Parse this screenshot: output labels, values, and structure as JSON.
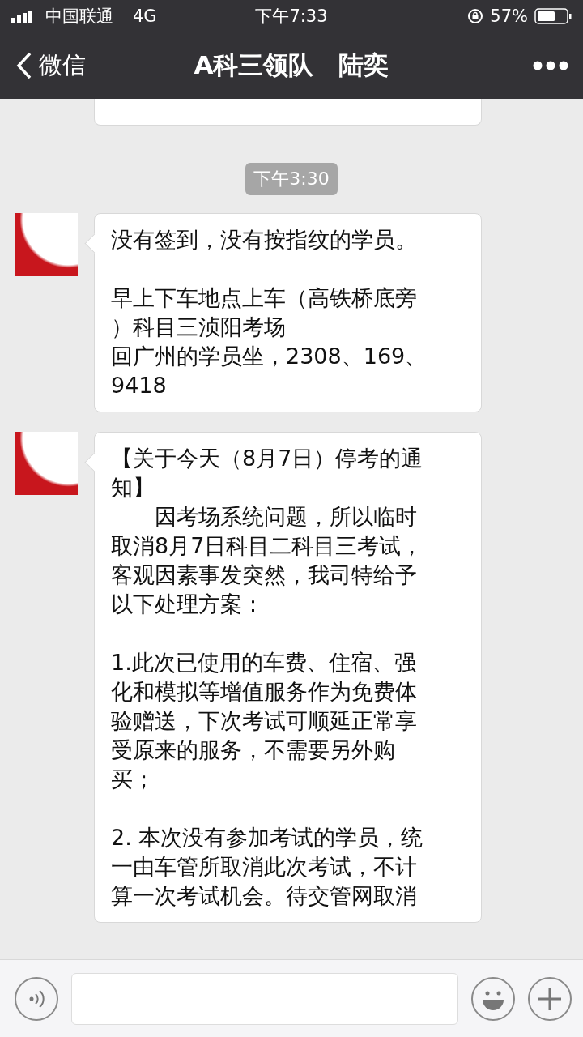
{
  "status_bar": {
    "carrier": "中国联通",
    "network": "4G",
    "time": "下午7:33",
    "battery_percent": "57%"
  },
  "nav_bar": {
    "back_label": "微信",
    "title": "A科三领队　陆奕"
  },
  "timestamp": "下午3:30",
  "messages": [
    {
      "paragraphs": [
        [
          "没有签到，没有按指纹的学员。"
        ],
        [
          "早上下车地点上车（高铁桥底旁",
          "）科目三浈阳考场",
          "回广州的学员坐，2308、169、",
          "9418"
        ]
      ]
    },
    {
      "paragraphs": [
        [
          "【关于今天（8月7日）停考的通",
          "知】",
          "　　因考场系统问题，所以临时",
          "取消8月7日科目二科目三考试，",
          "客观因素事发突然，我司特给予",
          "以下处理方案："
        ],
        [
          "1.此次已使用的车费、住宿、强",
          "化和模拟等增值服务作为免费体",
          "验赠送，下次考试可顺延正常享",
          "受原来的服务，不需要另外购",
          "买；"
        ],
        [
          "2. 本次没有参加考试的学员，统",
          "一由车管所取消此次考试，不计",
          "算一次考试机会。待交管网取消"
        ]
      ]
    }
  ]
}
